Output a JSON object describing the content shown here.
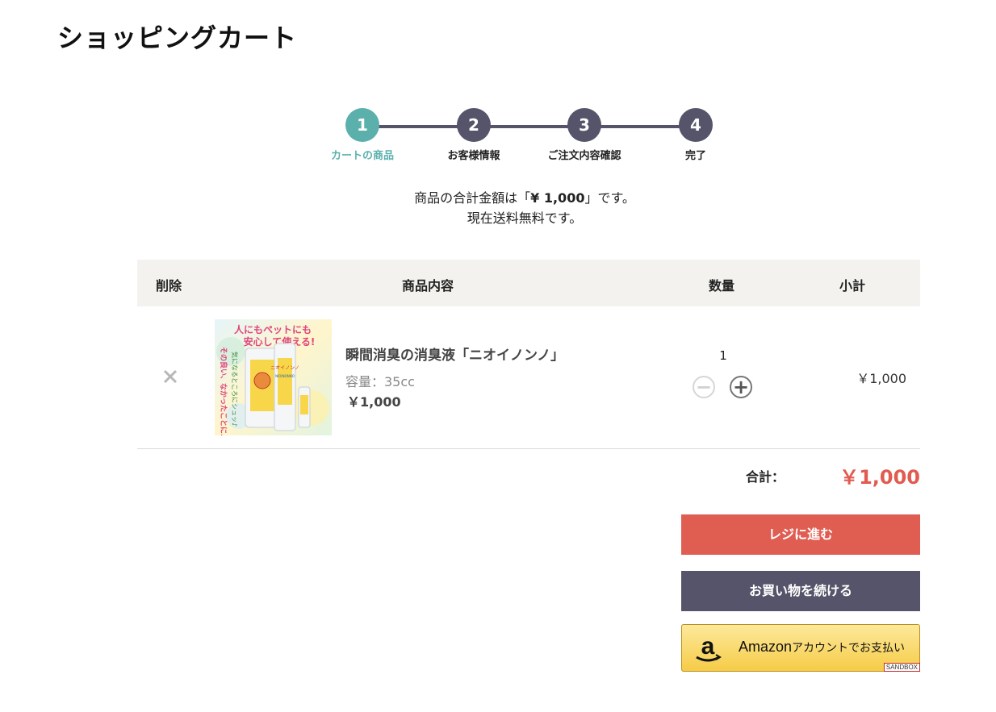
{
  "page": {
    "title": "ショッピングカート"
  },
  "steps": [
    {
      "number": "1",
      "label": "カートの商品",
      "active": true
    },
    {
      "number": "2",
      "label": "お客様情報",
      "active": false
    },
    {
      "number": "3",
      "label": "ご注文内容確認",
      "active": false
    },
    {
      "number": "4",
      "label": "完了",
      "active": false
    }
  ],
  "summary": {
    "prefix": "商品の合計金額は「",
    "amount": "¥ 1,000",
    "suffix": "」です。",
    "shipping": "現在送料無料です。"
  },
  "table": {
    "headers": {
      "remove": "削除",
      "product": "商品内容",
      "quantity": "数量",
      "subtotal": "小計"
    },
    "rows": [
      {
        "name": "瞬間消臭の消臭液「ニオイノンノ」",
        "capacity": "容量：35cc",
        "price": "￥1,000",
        "quantity": "1",
        "subtotal": "￥1,000",
        "image": {
          "banner_line1": "人にもペットにも",
          "banner_line2": "安心して使える!",
          "side_text": "気になるところにシュッ♪",
          "side_text2": "その良い、なかったことに♪",
          "bottle_label": "ニオイノンノ",
          "bottle_brand": "NIOINONNO"
        }
      }
    ]
  },
  "total": {
    "label": "合計：",
    "value": "￥1,000"
  },
  "buttons": {
    "checkout": "レジに進む",
    "continue": "お買い物を続ける"
  },
  "amazon_pay": {
    "text_main": "Amazon",
    "text_rest": "アカウントでお支払い",
    "badge": "SANDBOX"
  },
  "colors": {
    "accent_teal": "#5bb0ac",
    "step_dark": "#55546a",
    "price_red": "#e05b50",
    "checkout_red": "#e05d52"
  }
}
